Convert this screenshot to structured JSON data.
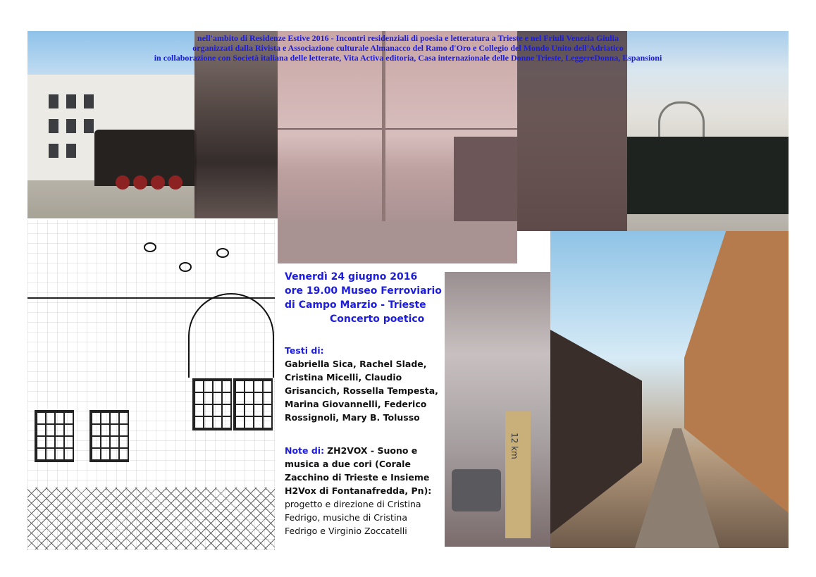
{
  "header": {
    "line1": "nell'ambito di Residenze Estive 2016 - Incontri residenziali di poesia e letteratura a Trieste e nel Friuli Venezia Giulia",
    "line2": "organizzati dalla Rivista e Associazione culturale Almanacco del Ramo d'Oro e Collegio del Mondo Unito dell'Adriatico",
    "line3": "in collaborazione con Società italiana delle letterate, Vita Activa editoria, Casa internazionale delle Donne Trieste, LeggereDonna, Espansioni"
  },
  "event": {
    "date": "Venerdì 24 giugno 2016",
    "time_place": "ore 19.00 Museo Ferroviario",
    "place2": "di Campo Marzio - Trieste",
    "title": "Concerto poetico"
  },
  "texts": {
    "label": "Testi di:",
    "lines": [
      "Gabriella Sica, Rachel Slade,",
      "Cristina Micelli, Claudio",
      "Grisancich, Rossella Tempesta,",
      "Marina Giovannelli, Federico",
      "Rossignoli, Mary B. Tolusso"
    ]
  },
  "notes": {
    "label": "Note di:",
    "first": "ZH2VOX - Suono e",
    "lines_bold": [
      "musica a due cori (Corale",
      "Zacchino di Trieste e Insieme",
      "H2Vox di Fontanafredda, Pn):"
    ],
    "lines": [
      "progetto e direzione di Cristina",
      "Fedrigo, musiche di Cristina",
      "Fedrigo e Virginio Zoccatelli"
    ]
  },
  "photo_text": {
    "milestone": "12 km"
  }
}
